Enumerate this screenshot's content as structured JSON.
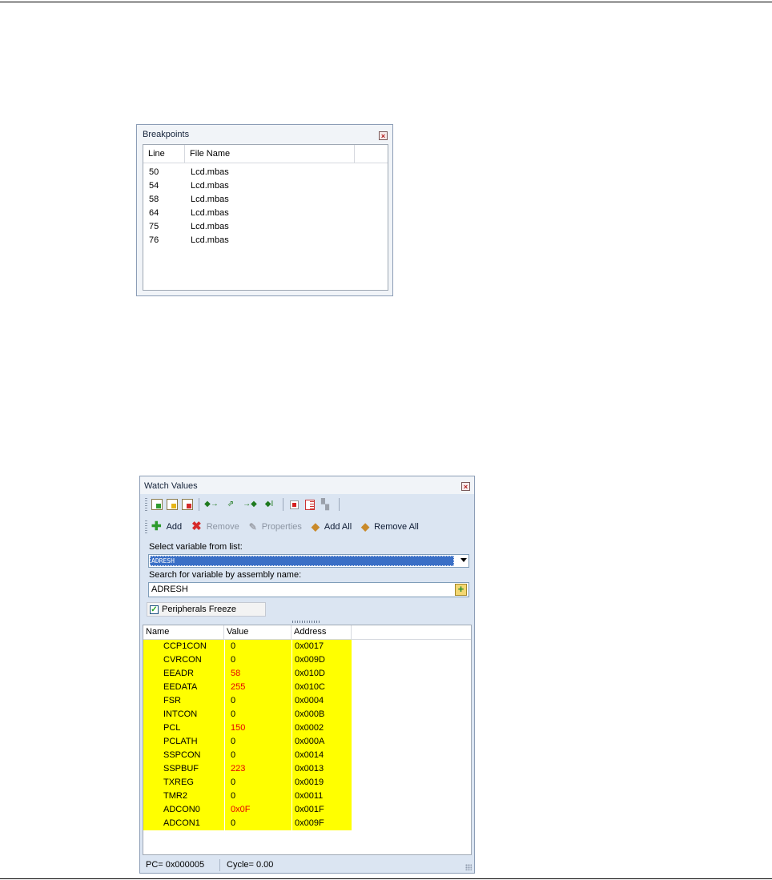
{
  "breakpoints": {
    "title": "Breakpoints",
    "close_glyph": "×",
    "columns": [
      "Line",
      "File Name",
      ""
    ],
    "rows": [
      {
        "line": "50",
        "file": "Lcd.mbas"
      },
      {
        "line": "54",
        "file": "Lcd.mbas"
      },
      {
        "line": "58",
        "file": "Lcd.mbas"
      },
      {
        "line": "64",
        "file": "Lcd.mbas"
      },
      {
        "line": "75",
        "file": "Lcd.mbas"
      },
      {
        "line": "76",
        "file": "Lcd.mbas"
      }
    ]
  },
  "watch": {
    "title": "Watch Values",
    "close_glyph": "×",
    "toolbar1_icons": [
      "add-document-icon",
      "edit-document-icon",
      "delete-document-icon",
      "step-into-icon",
      "step-over-icon",
      "step-out-icon",
      "run-to-cursor-icon",
      "stop-icon",
      "list-icon",
      "clear-icon"
    ],
    "toolbar2": {
      "add": "Add",
      "remove": "Remove",
      "properties": "Properties",
      "add_all": "Add All",
      "remove_all": "Remove All"
    },
    "select_label": "Select variable from list:",
    "select_value": "ADRESH",
    "search_label": "Search for variable by assembly name:",
    "search_value": "ADRESH",
    "freeze_label": "Peripherals Freeze",
    "freeze_checked": true,
    "columns": [
      "Name",
      "Value",
      "Address",
      ""
    ],
    "rows": [
      {
        "name": "CCP1CON",
        "value": "0",
        "address": "0x0017",
        "changed": false
      },
      {
        "name": "CVRCON",
        "value": "0",
        "address": "0x009D",
        "changed": false
      },
      {
        "name": "EEADR",
        "value": "58",
        "address": "0x010D",
        "changed": true
      },
      {
        "name": "EEDATA",
        "value": "255",
        "address": "0x010C",
        "changed": true
      },
      {
        "name": "FSR",
        "value": "0",
        "address": "0x0004",
        "changed": false
      },
      {
        "name": "INTCON",
        "value": "0",
        "address": "0x000B",
        "changed": false
      },
      {
        "name": "PCL",
        "value": "150",
        "address": "0x0002",
        "changed": true
      },
      {
        "name": "PCLATH",
        "value": "0",
        "address": "0x000A",
        "changed": false
      },
      {
        "name": "SSPCON",
        "value": "0",
        "address": "0x0014",
        "changed": false
      },
      {
        "name": "SSPBUF",
        "value": "223",
        "address": "0x0013",
        "changed": true
      },
      {
        "name": "TXREG",
        "value": "0",
        "address": "0x0019",
        "changed": false
      },
      {
        "name": "TMR2",
        "value": "0",
        "address": "0x0011",
        "changed": false
      },
      {
        "name": "ADCON0",
        "value": "0x0F",
        "address": "0x001F",
        "changed": true
      },
      {
        "name": "ADCON1",
        "value": "0",
        "address": "0x009F",
        "changed": false
      }
    ],
    "status_pc": "PC= 0x000005",
    "status_cycle": "Cycle= 0.00",
    "changed_color": "#e60000",
    "highlight_color": "#ffff00"
  }
}
